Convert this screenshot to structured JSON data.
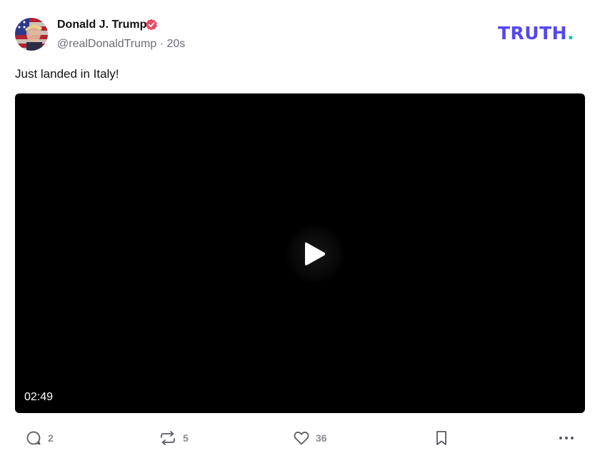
{
  "post": {
    "author_name": "Donald J. Trump",
    "handle": "@realDonaldTrump",
    "separator": "·",
    "timestamp": "20s",
    "text": "Just landed in Italy!",
    "verified": true
  },
  "brand": {
    "name": "TRUTH",
    "dot": ".",
    "color": "#5448ee",
    "dot_color": "#0ec6c6"
  },
  "video": {
    "duration": "02:49",
    "play_icon": "play-icon"
  },
  "actions": {
    "replies": "2",
    "retruths": "5",
    "likes": "36",
    "bookmark_icon": "bookmark-icon",
    "more_icon": "more-icon"
  },
  "colors": {
    "verified_badge": "#e94b64",
    "muted_text": "#6b6b76"
  }
}
